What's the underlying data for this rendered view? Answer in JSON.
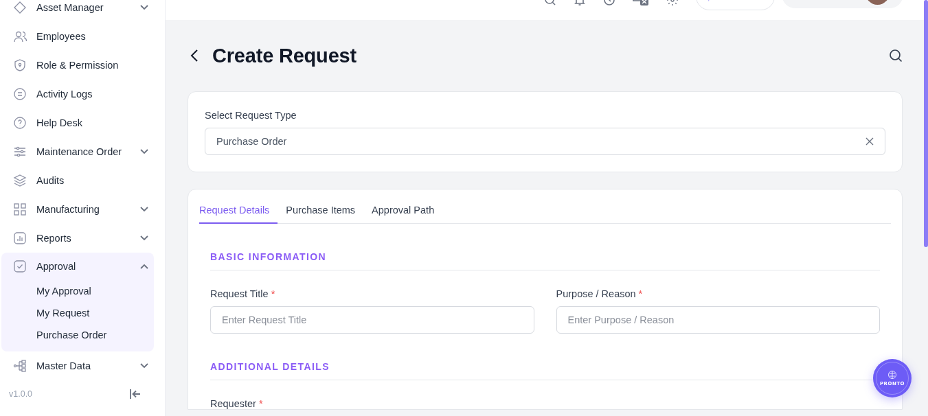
{
  "sidebar": {
    "items": [
      {
        "label": "Asset Manager",
        "selected": false,
        "expanded": false
      },
      {
        "label": "Employees",
        "selected": false
      },
      {
        "label": "Role & Permission",
        "selected": false
      },
      {
        "label": "Activity Logs",
        "selected": false
      },
      {
        "label": "Help Desk",
        "selected": false
      },
      {
        "label": "Maintenance Order",
        "selected": false,
        "expanded": false
      },
      {
        "label": "Audits",
        "selected": false
      },
      {
        "label": "Manufacturing",
        "selected": false,
        "expanded": false
      },
      {
        "label": "Reports",
        "selected": false,
        "expanded": false
      },
      {
        "label": "Approval",
        "selected": true,
        "expanded": true,
        "children": [
          {
            "label": "My Approval",
            "selected": false
          },
          {
            "label": "My Request",
            "selected": false
          },
          {
            "label": "Purchase Order",
            "selected": false
          }
        ]
      },
      {
        "label": "Master Data",
        "selected": false,
        "expanded": false
      }
    ],
    "version": "v1.0.0"
  },
  "page": {
    "title": "Create Request"
  },
  "request_type": {
    "label": "Select Request Type",
    "value": "Purchase Order"
  },
  "tabs": [
    {
      "label": "Request Details",
      "selected": true
    },
    {
      "label": "Purchase Items",
      "selected": false
    },
    {
      "label": "Approval Path",
      "selected": false
    }
  ],
  "sections": [
    {
      "title": "BASIC INFORMATION",
      "fields": [
        {
          "label": "Request Title",
          "required": true,
          "placeholder": "Enter Request Title"
        },
        {
          "label": "Purpose / Reason",
          "required": true,
          "placeholder": "Enter Purpose / Reason"
        }
      ]
    },
    {
      "title": "ADDITIONAL DETAILS",
      "fields": [
        {
          "label": "Requester",
          "required": true
        }
      ]
    }
  ],
  "required_mark": "*",
  "assistant_button": {
    "label": "PRONTO"
  }
}
